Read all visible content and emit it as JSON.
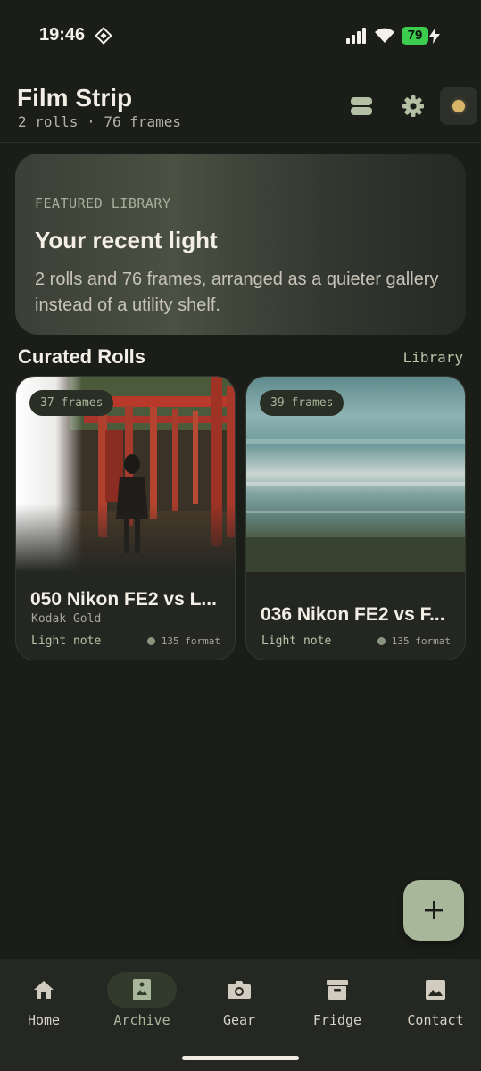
{
  "status_bar": {
    "time": "19:46",
    "battery": "79"
  },
  "header": {
    "title": "Film Strip",
    "subtitle": "2 rolls · 76 frames"
  },
  "featured": {
    "label": "FEATURED LIBRARY",
    "title": "Your recent light",
    "description": "2 rolls and 76 frames, arranged as a quieter gallery instead of a utility shelf."
  },
  "section": {
    "title": "Curated Rolls",
    "link": "Library"
  },
  "rolls": [
    {
      "frames": "37 frames",
      "title": "050 Nikon FE2 vs L...",
      "stock": "Kodak Gold",
      "note": "Light note",
      "format": "135 format"
    },
    {
      "frames": "39 frames",
      "title": "036 Nikon FE2 vs F...",
      "stock": "",
      "note": "Light note",
      "format": "135 format"
    }
  ],
  "fab": {
    "icon": "plus-icon"
  },
  "nav": {
    "items": [
      {
        "label": "Home",
        "icon": "home-icon"
      },
      {
        "label": "Archive",
        "icon": "archive-photo-icon",
        "active": true
      },
      {
        "label": "Gear",
        "icon": "camera-icon"
      },
      {
        "label": "Fridge",
        "icon": "box-icon"
      },
      {
        "label": "Contact",
        "icon": "image-icon"
      }
    ]
  },
  "colors": {
    "background": "#1b1d19",
    "accent": "#a8b69a",
    "battery": "#3ccd4f"
  }
}
